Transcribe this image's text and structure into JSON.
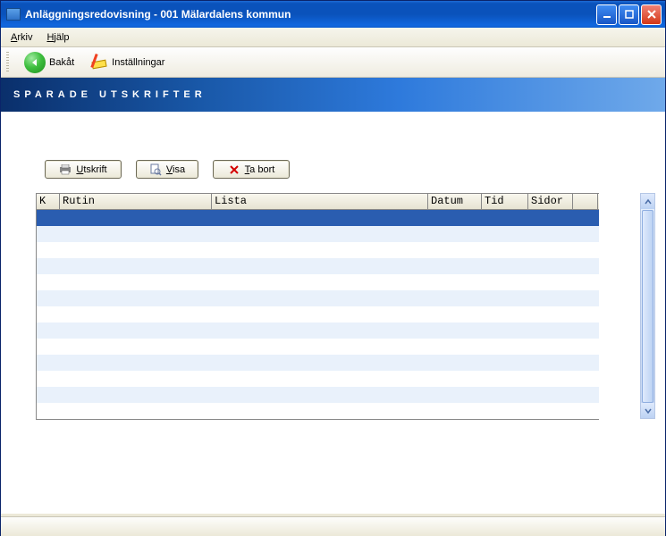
{
  "window": {
    "title": "Anläggningsredovisning  -  001 Mälardalens kommun"
  },
  "menu": {
    "arkiv_prefix": "A",
    "arkiv_rest": "rkiv",
    "hjalp_prefix": "H",
    "hjalp_rest": "jälp"
  },
  "toolbar": {
    "back_label": "Bakåt",
    "settings_label": "Inställningar"
  },
  "banner": {
    "title": "SPARADE UTSKRIFTER"
  },
  "buttons": {
    "print_prefix": "U",
    "print_rest": "tskrift",
    "show_prefix": "V",
    "show_rest": "isa",
    "delete_prefix": "T",
    "delete_rest": "a bort"
  },
  "table": {
    "headers": {
      "k": "K",
      "rutin": "Rutin",
      "lista": "Lista",
      "datum": "Datum",
      "tid": "Tid",
      "sidor": "Sidor"
    }
  }
}
